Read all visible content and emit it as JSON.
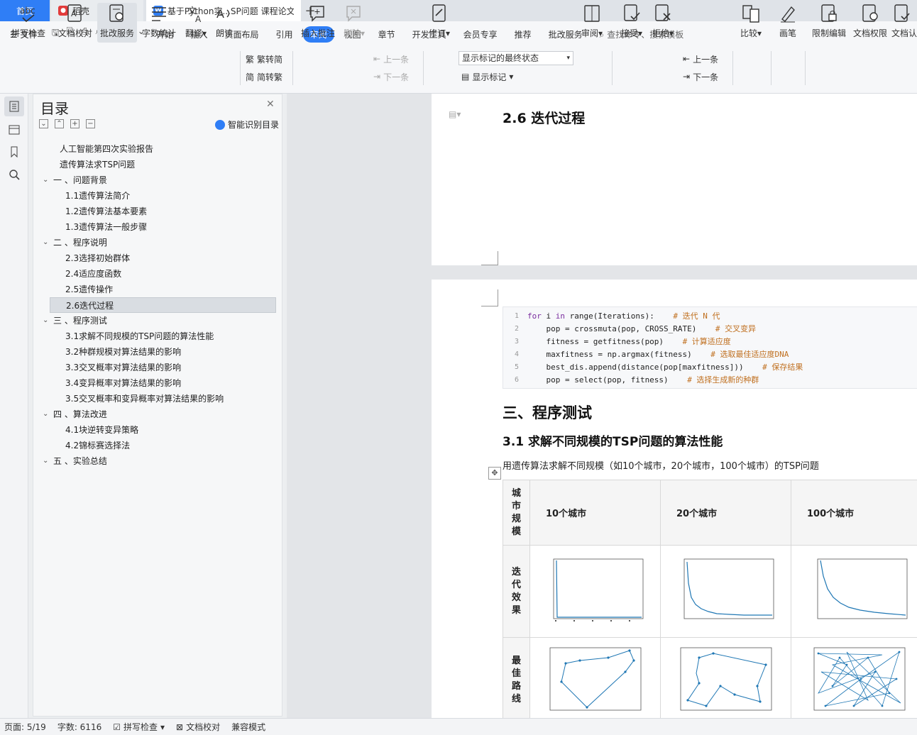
{
  "tabs": {
    "home": "首页",
    "daoke": "稻壳",
    "doc": "基于Python实...SP问题 课程论文",
    "doc_icon": "W",
    "add": "+"
  },
  "menubar": {
    "file": "文件",
    "items": [
      "开始",
      "插入",
      "页面布局",
      "引用",
      "审阅",
      "视图",
      "章节",
      "开发工具",
      "会员专享",
      "推荐",
      "批改服务"
    ],
    "active": "审阅",
    "search": "查找命令、搜索模板"
  },
  "ribbon": {
    "spell": "拼写检查",
    "proof": "文档校对",
    "grade": "批改服务",
    "count": "字数统计",
    "translate": "翻译",
    "read": "朗读",
    "t2s": "繁转简",
    "s2t": "简转繁",
    "comment": "插入批注",
    "delete": "删除",
    "prev_comment": "上一条",
    "next_comment": "下一条",
    "revise": "修订",
    "markup_state": "显示标记的最终状态",
    "show_markup": "显示标记",
    "review": "审阅",
    "accept": "接受",
    "reject": "拒绝",
    "prev": "上一条",
    "next": "下一条",
    "compare": "比较",
    "pen": "画笔",
    "restrict": "限制编辑",
    "permission": "文档权限",
    "doc_auth": "文档认"
  },
  "toc": {
    "title": "目录",
    "ai_label": "智能识别目录",
    "items": [
      {
        "label": "人工智能第四次实验报告",
        "level": 0
      },
      {
        "label": "遗传算法求TSP问题",
        "level": 0
      },
      {
        "label": "一 、问题背景",
        "level": 1
      },
      {
        "label": "1.1遗传算法简介",
        "level": 2
      },
      {
        "label": "1.2遗传算法基本要素",
        "level": 2
      },
      {
        "label": "1.3遗传算法一般步骤",
        "level": 2
      },
      {
        "label": "二 、程序说明",
        "level": 1
      },
      {
        "label": "2.3选择初始群体",
        "level": 2
      },
      {
        "label": "2.4适应度函数",
        "level": 2
      },
      {
        "label": "2.5遗传操作",
        "level": 2
      },
      {
        "label": "2.6迭代过程",
        "level": 2,
        "selected": true
      },
      {
        "label": "三 、程序测试",
        "level": 1
      },
      {
        "label": "3.1求解不同规模的TSP问题的算法性能",
        "level": 2
      },
      {
        "label": "3.2种群规模对算法结果的影响",
        "level": 2
      },
      {
        "label": "3.3交叉概率对算法结果的影响",
        "level": 2
      },
      {
        "label": "3.4变异概率对算法结果的影响",
        "level": 2
      },
      {
        "label": "3.5交叉概率和变异概率对算法结果的影响",
        "level": 2
      },
      {
        "label": "四 、算法改进",
        "level": 1
      },
      {
        "label": "4.1块逆转变异策略",
        "level": 2
      },
      {
        "label": "4.2锦标赛选择法",
        "level": 2
      },
      {
        "label": "五 、实验总结",
        "level": 1
      }
    ]
  },
  "doc": {
    "h_26": "2.6 迭代过程",
    "code": [
      {
        "n": "1",
        "code": "for i in range(Iterations):",
        "comment": "# 迭代 N 代"
      },
      {
        "n": "2",
        "code": "    pop = crossmuta(pop, CROSS_RATE)",
        "comment": "# 交叉变异"
      },
      {
        "n": "3",
        "code": "    fitness = getfitness(pop)",
        "comment": "# 计算适应度"
      },
      {
        "n": "4",
        "code": "    maxfitness = np.argmax(fitness)",
        "comment": "# 选取最佳适应度DNA"
      },
      {
        "n": "5",
        "code": "    best_dis.append(distance(pop[maxfitness]))",
        "comment": "# 保存结果"
      },
      {
        "n": "6",
        "code": "    pop = select(pop, fitness)",
        "comment": "# 选择生成新的种群"
      }
    ],
    "h_3": "三、程序测试",
    "h_31": "3.1 求解不同规模的TSP问题的算法性能",
    "para": "用遗传算法求解不同规模（如10个城市，20个城市，100个城市）的TSP问题",
    "table": {
      "corner": "城市规模",
      "cols": [
        "10个城市",
        "20个城市",
        "100个城市"
      ],
      "row1": "迭代效果",
      "row2": "最佳路线"
    }
  },
  "status": {
    "page": "页面: 5/19",
    "words": "字数: 6116",
    "spell": "拼写检查",
    "proof": "文档校对",
    "compat": "兼容模式"
  }
}
